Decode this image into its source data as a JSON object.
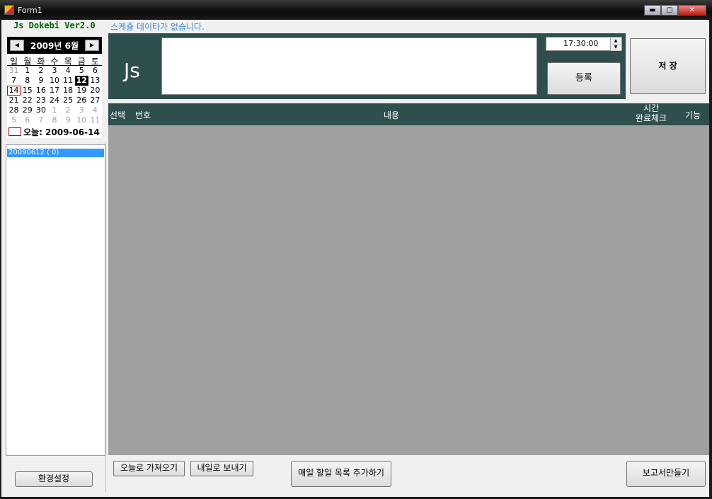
{
  "window": {
    "title": "Form1",
    "minimize": "▬",
    "maximize": "▢",
    "close": "✕"
  },
  "app": {
    "name": "Js Dokebi Ver2.0",
    "status": "스케쥴 데이타가 없습니다."
  },
  "calendar": {
    "month_label": "2009년 6월",
    "prev": "◀",
    "next": "▶",
    "weekdays": [
      "일",
      "월",
      "화",
      "수",
      "목",
      "금",
      "토"
    ],
    "days": [
      {
        "n": "31",
        "other": true
      },
      {
        "n": "1"
      },
      {
        "n": "2"
      },
      {
        "n": "3"
      },
      {
        "n": "4"
      },
      {
        "n": "5"
      },
      {
        "n": "6"
      },
      {
        "n": "7"
      },
      {
        "n": "8"
      },
      {
        "n": "9"
      },
      {
        "n": "10"
      },
      {
        "n": "11"
      },
      {
        "n": "12",
        "selected": true
      },
      {
        "n": "13"
      },
      {
        "n": "14",
        "today": true
      },
      {
        "n": "15"
      },
      {
        "n": "16"
      },
      {
        "n": "17"
      },
      {
        "n": "18"
      },
      {
        "n": "19"
      },
      {
        "n": "20"
      },
      {
        "n": "21"
      },
      {
        "n": "22"
      },
      {
        "n": "23"
      },
      {
        "n": "24"
      },
      {
        "n": "25"
      },
      {
        "n": "26"
      },
      {
        "n": "27"
      },
      {
        "n": "28"
      },
      {
        "n": "29"
      },
      {
        "n": "30"
      },
      {
        "n": "1",
        "other": true
      },
      {
        "n": "2",
        "other": true
      },
      {
        "n": "3",
        "other": true
      },
      {
        "n": "4",
        "other": true
      },
      {
        "n": "5",
        "other": true
      },
      {
        "n": "6",
        "other": true
      },
      {
        "n": "7",
        "other": true
      },
      {
        "n": "8",
        "other": true
      },
      {
        "n": "9",
        "other": true
      },
      {
        "n": "10",
        "other": true
      },
      {
        "n": "11",
        "other": true
      }
    ],
    "today_label": "오늘: 2009-06-14"
  },
  "date_list": {
    "items": [
      "20090612 ( 0)"
    ]
  },
  "settings_button": "환경설정",
  "entry": {
    "logo": "Js",
    "memo_value": "",
    "time_value": "17:30:00",
    "register_button": "등록"
  },
  "save_button": "저 장",
  "grid": {
    "columns": {
      "select": "선택",
      "number": "번호",
      "content": "내용",
      "time_line1": "시간",
      "time_line2": "완료체크",
      "function": "기능"
    }
  },
  "buttons": {
    "bring_today": "오늘로 가져오기",
    "send_tomorrow": "내일로 보내기",
    "add_daily": "매일 할일 목록 추가하기",
    "make_report": "보고서만들기"
  },
  "colors": {
    "panel": "#2f4f4f",
    "grid_bg": "#a0a0a0",
    "accent_green": "#006400",
    "status_blue": "#3a8bd0",
    "list_select": "#3399ff"
  }
}
